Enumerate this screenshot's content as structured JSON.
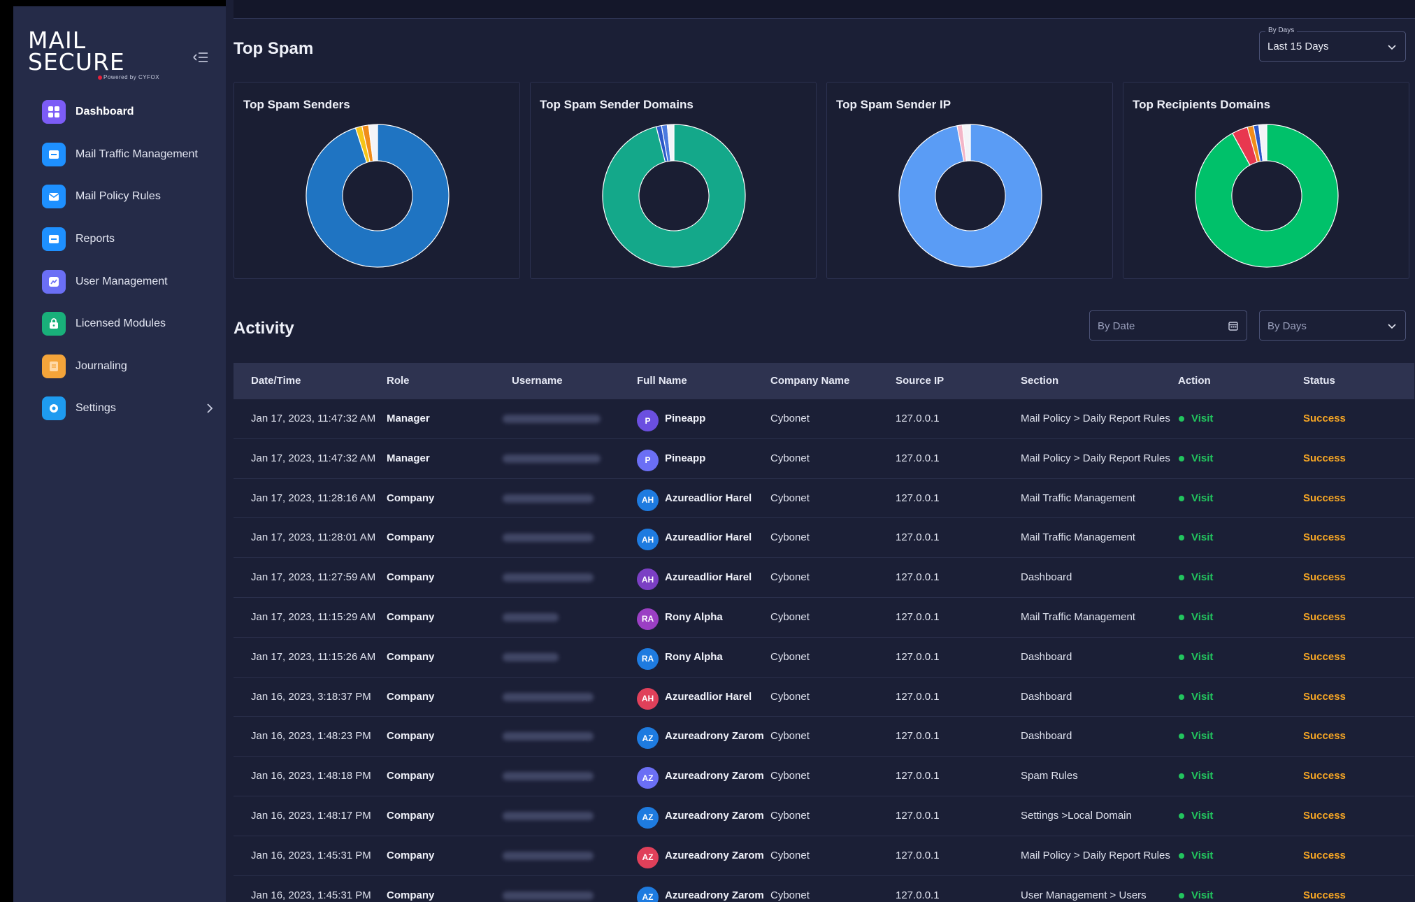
{
  "brand": {
    "line1": "MAIL",
    "line2": "SECURE",
    "tagline": "Powered by CYFOX"
  },
  "sidebar": {
    "items": [
      {
        "label": "Dashboard",
        "icon": "dashboard-icon",
        "color": "#7c5cf6",
        "active": true
      },
      {
        "label": "Mail Traffic Management",
        "icon": "mail-traffic-icon",
        "color": "#1e90ff"
      },
      {
        "label": "Mail Policy Rules",
        "icon": "mail-policy-icon",
        "color": "#1e90ff"
      },
      {
        "label": "Reports",
        "icon": "reports-icon",
        "color": "#1e90ff"
      },
      {
        "label": "User Management",
        "icon": "user-management-icon",
        "color": "#6b6ff5"
      },
      {
        "label": "Licensed Modules",
        "icon": "licensed-modules-icon",
        "color": "#19b07a"
      },
      {
        "label": "Journaling",
        "icon": "journaling-icon",
        "color": "#f4a43a"
      },
      {
        "label": "Settings",
        "icon": "settings-icon",
        "color": "#1e9bf0"
      }
    ]
  },
  "top_spam": {
    "title": "Top Spam",
    "filter": {
      "legend": "By Days",
      "value": "Last 15 Days"
    },
    "charts": [
      {
        "title": "Top Spam Senders",
        "slices": [
          {
            "value": 95,
            "color": "#1f74c2"
          },
          {
            "value": 1.5,
            "color": "#f5c518"
          },
          {
            "value": 1.5,
            "color": "#f08c1a"
          },
          {
            "value": 2,
            "color": "#f3f4f8"
          }
        ]
      },
      {
        "title": "Top Spam Sender Domains",
        "slices": [
          {
            "value": 96,
            "color": "#14a88a"
          },
          {
            "value": 1.2,
            "color": "#2b58c8"
          },
          {
            "value": 1.3,
            "color": "#4a7adf"
          },
          {
            "value": 1.5,
            "color": "#f3f4f8"
          }
        ]
      },
      {
        "title": "Top Spam Sender IP",
        "slices": [
          {
            "value": 97,
            "color": "#5a9cf5"
          },
          {
            "value": 1.2,
            "color": "#f3b6c8"
          },
          {
            "value": 1.8,
            "color": "#f3f4f8"
          }
        ]
      },
      {
        "title": "Top Recipients Domains",
        "slices": [
          {
            "value": 92,
            "color": "#00c16a"
          },
          {
            "value": 3.6,
            "color": "#e8384f"
          },
          {
            "value": 1.4,
            "color": "#f08c1a"
          },
          {
            "value": 1.2,
            "color": "#2b58c8"
          },
          {
            "value": 1.8,
            "color": "#f3f4f8"
          }
        ]
      }
    ]
  },
  "activity": {
    "title": "Activity",
    "date_placeholder": "By Date",
    "days_placeholder": "By Days",
    "columns": [
      "Date/Time",
      "Role",
      "Username",
      "Full Name",
      "Company Name",
      "Source IP",
      "Section",
      "Action",
      "Status"
    ],
    "rows": [
      {
        "datetime": "Jan 17, 2023, 11:47:32 AM",
        "role": "Manager",
        "initials": "P",
        "avatar": "#6b4fe0",
        "name": "Pineapp",
        "company": "Cybonet",
        "ip": "127.0.0.1",
        "section": "Mail Policy > Daily Report Rules",
        "action": "Visit",
        "status": "Success"
      },
      {
        "datetime": "Jan 17, 2023, 11:47:32 AM",
        "role": "Manager",
        "initials": "P",
        "avatar": "#6b6ff5",
        "name": "Pineapp",
        "company": "Cybonet",
        "ip": "127.0.0.1",
        "section": "Mail Policy > Daily Report Rules",
        "action": "Visit",
        "status": "Success"
      },
      {
        "datetime": "Jan 17, 2023, 11:28:16 AM",
        "role": "Company",
        "initials": "AH",
        "avatar": "#1e7be0",
        "name": "Azureadlior Harel",
        "company": "Cybonet",
        "ip": "127.0.0.1",
        "section": "Mail Traffic Management",
        "action": "Visit",
        "status": "Success"
      },
      {
        "datetime": "Jan 17, 2023, 11:28:01 AM",
        "role": "Company",
        "initials": "AH",
        "avatar": "#1e7be0",
        "name": "Azureadlior Harel",
        "company": "Cybonet",
        "ip": "127.0.0.1",
        "section": "Mail Traffic Management",
        "action": "Visit",
        "status": "Success"
      },
      {
        "datetime": "Jan 17, 2023, 11:27:59 AM",
        "role": "Company",
        "initials": "AH",
        "avatar": "#7b3fc4",
        "name": "Azureadlior Harel",
        "company": "Cybonet",
        "ip": "127.0.0.1",
        "section": "Dashboard",
        "action": "Visit",
        "status": "Success"
      },
      {
        "datetime": "Jan 17, 2023, 11:15:29 AM",
        "role": "Company",
        "initials": "RA",
        "avatar": "#9b3fc4",
        "name": "Rony Alpha",
        "company": "Cybonet",
        "ip": "127.0.0.1",
        "section": "Mail Traffic Management",
        "action": "Visit",
        "status": "Success"
      },
      {
        "datetime": "Jan 17, 2023, 11:15:26 AM",
        "role": "Company",
        "initials": "RA",
        "avatar": "#1e7be0",
        "name": "Rony Alpha",
        "company": "Cybonet",
        "ip": "127.0.0.1",
        "section": "Dashboard",
        "action": "Visit",
        "status": "Success"
      },
      {
        "datetime": "Jan 16, 2023, 3:18:37 PM",
        "role": "Company",
        "initials": "AH",
        "avatar": "#e0405a",
        "name": "Azureadlior Harel",
        "company": "Cybonet",
        "ip": "127.0.0.1",
        "section": "Dashboard",
        "action": "Visit",
        "status": "Success"
      },
      {
        "datetime": "Jan 16, 2023, 1:48:23 PM",
        "role": "Company",
        "initials": "AZ",
        "avatar": "#1e7be0",
        "name": "Azureadrony Zarom",
        "company": "Cybonet",
        "ip": "127.0.0.1",
        "section": "Dashboard",
        "action": "Visit",
        "status": "Success"
      },
      {
        "datetime": "Jan 16, 2023, 1:48:18 PM",
        "role": "Company",
        "initials": "AZ",
        "avatar": "#6b6ff5",
        "name": "Azureadrony Zarom",
        "company": "Cybonet",
        "ip": "127.0.0.1",
        "section": "Spam Rules",
        "action": "Visit",
        "status": "Success"
      },
      {
        "datetime": "Jan 16, 2023, 1:48:17 PM",
        "role": "Company",
        "initials": "AZ",
        "avatar": "#1e7be0",
        "name": "Azureadrony Zarom",
        "company": "Cybonet",
        "ip": "127.0.0.1",
        "section": "Settings >Local Domain",
        "action": "Visit",
        "status": "Success"
      },
      {
        "datetime": "Jan 16, 2023, 1:45:31 PM",
        "role": "Company",
        "initials": "AZ",
        "avatar": "#e0405a",
        "name": "Azureadrony Zarom",
        "company": "Cybonet",
        "ip": "127.0.0.1",
        "section": "Mail Policy > Daily Report Rules",
        "action": "Visit",
        "status": "Success"
      },
      {
        "datetime": "Jan 16, 2023, 1:45:31 PM",
        "role": "Company",
        "initials": "AZ",
        "avatar": "#1e7be0",
        "name": "Azureadrony Zarom",
        "company": "Cybonet",
        "ip": "127.0.0.1",
        "section": "User Management > Users",
        "action": "Visit",
        "status": "Success"
      }
    ]
  }
}
